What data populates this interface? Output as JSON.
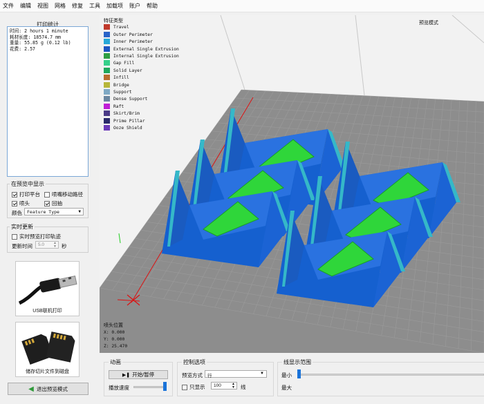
{
  "menu": [
    "文件",
    "编辑",
    "视图",
    "网格",
    "修复",
    "工具",
    "加载项",
    "账户",
    "帮助"
  ],
  "stats": {
    "title": "打印统计",
    "lines": [
      "时间: 2 hours 1 minute",
      "耗材长度: 18574.7 mm",
      "重量: 55.85 g (0.12 lb)",
      "花费: 2.57"
    ]
  },
  "show": {
    "title": "在预览中显示",
    "print_bed": "打印平台",
    "nozzle_moves": "喷嘴移动路径",
    "nozzle": "喷头",
    "retract": "回抽",
    "color_label": "颜色",
    "color_value": "Feature Type"
  },
  "realtime": {
    "title": "实时更新",
    "realtime_track": "实时预览打印轨迹",
    "update_time_label": "更新时间",
    "update_time_value": "5.0",
    "unit": "秒"
  },
  "usb": {
    "caption": "USB联机打印"
  },
  "save": {
    "caption": "储存切片文件到磁盘"
  },
  "exit_button": "退出预览模式",
  "legend": {
    "title": "特征类型",
    "items": [
      {
        "label": "Travel",
        "color": "#c0392b"
      },
      {
        "label": "Outer Perimeter",
        "color": "#2a64c8"
      },
      {
        "label": "Inner Perimeter",
        "color": "#27a8d8"
      },
      {
        "label": "External Single Extrusion",
        "color": "#1e55c0"
      },
      {
        "label": "Internal Single Extrusion",
        "color": "#2f9e43"
      },
      {
        "label": "Gap Fill",
        "color": "#35d08a"
      },
      {
        "label": "Solid Layer",
        "color": "#1fa85c"
      },
      {
        "label": "Infill",
        "color": "#b86d2f"
      },
      {
        "label": "Bridge",
        "color": "#b6b63a"
      },
      {
        "label": "Support",
        "color": "#7fa9c4"
      },
      {
        "label": "Dense Support",
        "color": "#6a86a0"
      },
      {
        "label": "Raft",
        "color": "#c01fd6"
      },
      {
        "label": "Skirt/Brim",
        "color": "#4a3a86"
      },
      {
        "label": "Prime Pillar",
        "color": "#2a2a6a"
      },
      {
        "label": "Ooze Shield",
        "color": "#6a3ab8"
      }
    ]
  },
  "preview_mode": "预览模式",
  "nozzle_pos": {
    "title": "喷头位置",
    "x": "X: 0.000",
    "y": "Y: 0.000",
    "z": "Z: 25.470"
  },
  "animation": {
    "title": "动画",
    "play_pause": "开始/暂停",
    "speed_label": "播放速度"
  },
  "control": {
    "title": "控制选项",
    "mode_label": "预览方式",
    "mode_value": "行",
    "only_show": "只显示",
    "count": "100",
    "unit": "线"
  },
  "range": {
    "title": "线显示范围",
    "min": "最小",
    "max": "最大"
  }
}
